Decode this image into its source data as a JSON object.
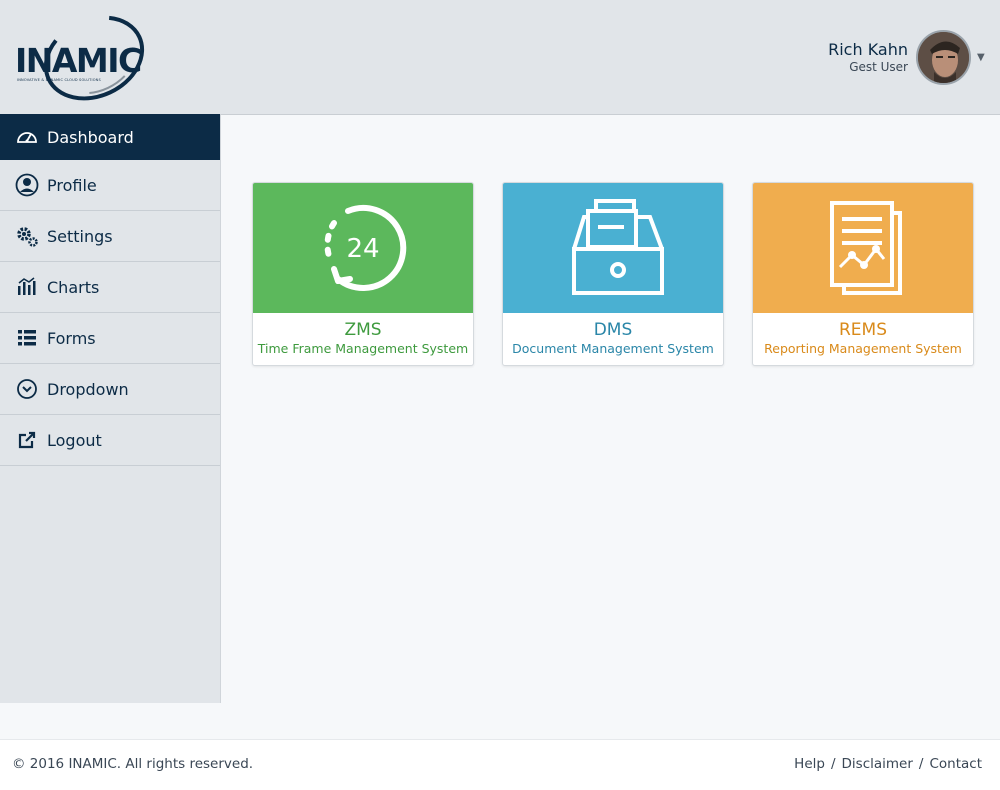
{
  "header": {
    "logo_text": "INAMIC",
    "logo_tagline": "INNOVATIVE & DYNAMIC CLOUD SOLUTIONS",
    "user_name": "Rich Kahn",
    "user_role": "Gest User"
  },
  "sidebar": {
    "items": [
      {
        "label": "Dashboard",
        "icon": "dashboard-gauge-icon",
        "active": true
      },
      {
        "label": "Profile",
        "icon": "user-icon"
      },
      {
        "label": "Settings",
        "icon": "gears-icon"
      },
      {
        "label": "Charts",
        "icon": "bar-chart-icon"
      },
      {
        "label": "Forms",
        "icon": "list-icon"
      },
      {
        "label": "Dropdown",
        "icon": "chevron-circle-down-icon"
      },
      {
        "label": "Logout",
        "icon": "external-link-icon"
      }
    ]
  },
  "cards": [
    {
      "title": "ZMS",
      "subtitle": "Time Frame Management System",
      "color": "#5cb85c",
      "text_color": "#3e9a3e",
      "icon": "24-hour-clock-icon",
      "icon_text": "24"
    },
    {
      "title": "DMS",
      "subtitle": "Document Management System",
      "color": "#4ab0d2",
      "text_color": "#2a86a8",
      "icon": "file-archive-icon"
    },
    {
      "title": "REMS",
      "subtitle": "Reporting Management System",
      "color": "#f0ad4e",
      "text_color": "#d98a1a",
      "icon": "report-document-icon"
    }
  ],
  "footer": {
    "copyright": "© 2016 INAMIC. All rights reserved.",
    "links": [
      "Help",
      "Disclaimer",
      "Contact"
    ],
    "separator": "/"
  },
  "colors": {
    "primary": "#0c2b46",
    "header_bg": "#e1e5e9",
    "content_bg": "#f6f8fa"
  }
}
